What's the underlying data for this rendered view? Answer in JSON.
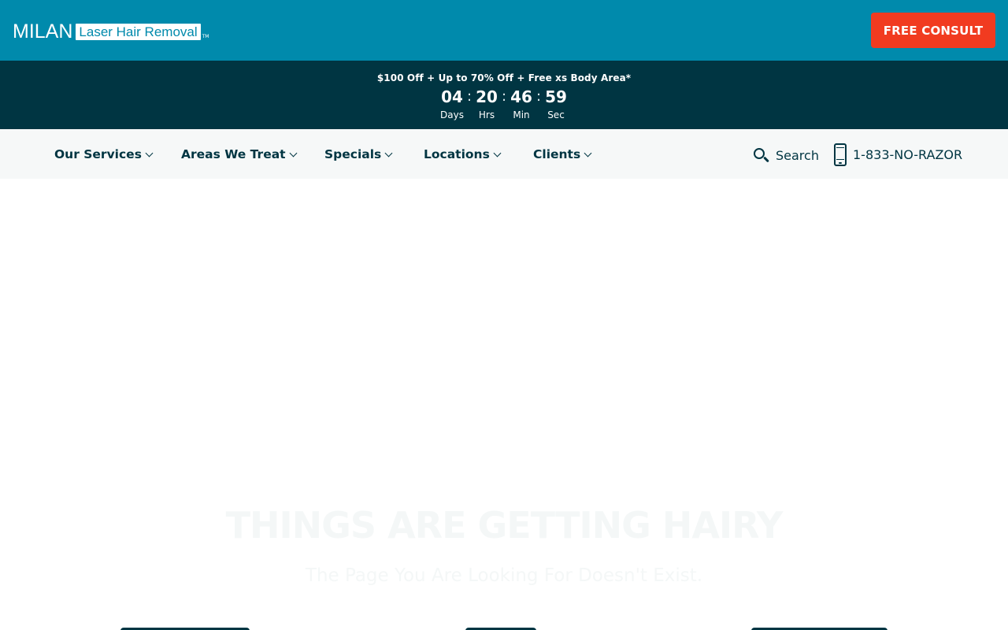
{
  "header": {
    "logo_brand": "MILAN",
    "logo_tagline": "Laser Hair Removal",
    "logo_tm": "TM",
    "consult_label": "FREE CONSULT",
    "background": "#008aac",
    "cta_color": "#f13b20"
  },
  "promo": {
    "text": "$100 Off + Up to 70% Off + Free xs Body Area*",
    "background": "#003542",
    "countdown": [
      {
        "value": "04",
        "label": "Days"
      },
      {
        "value": "20",
        "label": "Hrs"
      },
      {
        "value": "46",
        "label": "Min"
      },
      {
        "value": "59",
        "label": "Sec"
      }
    ],
    "separator": ":"
  },
  "nav": {
    "items": [
      {
        "label": "Our Services"
      },
      {
        "label": "Areas We Treat"
      },
      {
        "label": "Specials"
      },
      {
        "label": "Locations"
      },
      {
        "label": "Clients"
      }
    ],
    "search_label": "Search",
    "phone": "1-833-NO-RAZOR"
  },
  "main": {
    "title": "THINGS ARE GETTING HAIRY",
    "subtitle": "The Page You Are Looking For Doesn't Exist."
  }
}
